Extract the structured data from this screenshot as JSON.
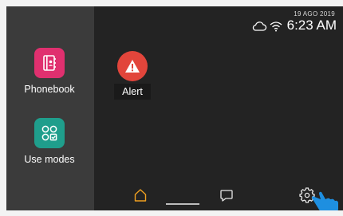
{
  "status_bar": {
    "date": "19 AGO 2019",
    "time": "6:23 AM",
    "icons": [
      "cloud-icon",
      "wifi-icon"
    ]
  },
  "sidebar": {
    "apps": [
      {
        "label": "Phonebook",
        "icon": "phonebook-icon",
        "color": "#e0306f"
      },
      {
        "label": "Use modes",
        "icon": "use-modes-icon",
        "color": "#1f9e8c"
      }
    ]
  },
  "main": {
    "apps": [
      {
        "label": "Alert",
        "icon": "alert-icon",
        "color": "#e2453b"
      }
    ]
  },
  "bottom_bar": {
    "buttons": [
      "home-icon",
      "chat-icon",
      "settings-icon"
    ],
    "active": "home",
    "accent": "#f0a020"
  }
}
